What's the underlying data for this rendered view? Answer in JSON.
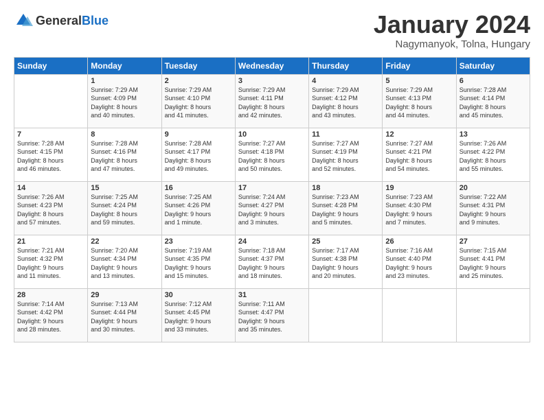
{
  "logo": {
    "general": "General",
    "blue": "Blue"
  },
  "header": {
    "month": "January 2024",
    "location": "Nagymanyok, Tolna, Hungary"
  },
  "days_of_week": [
    "Sunday",
    "Monday",
    "Tuesday",
    "Wednesday",
    "Thursday",
    "Friday",
    "Saturday"
  ],
  "weeks": [
    [
      {
        "day": "",
        "info": ""
      },
      {
        "day": "1",
        "info": "Sunrise: 7:29 AM\nSunset: 4:09 PM\nDaylight: 8 hours\nand 40 minutes."
      },
      {
        "day": "2",
        "info": "Sunrise: 7:29 AM\nSunset: 4:10 PM\nDaylight: 8 hours\nand 41 minutes."
      },
      {
        "day": "3",
        "info": "Sunrise: 7:29 AM\nSunset: 4:11 PM\nDaylight: 8 hours\nand 42 minutes."
      },
      {
        "day": "4",
        "info": "Sunrise: 7:29 AM\nSunset: 4:12 PM\nDaylight: 8 hours\nand 43 minutes."
      },
      {
        "day": "5",
        "info": "Sunrise: 7:29 AM\nSunset: 4:13 PM\nDaylight: 8 hours\nand 44 minutes."
      },
      {
        "day": "6",
        "info": "Sunrise: 7:28 AM\nSunset: 4:14 PM\nDaylight: 8 hours\nand 45 minutes."
      }
    ],
    [
      {
        "day": "7",
        "info": "Sunrise: 7:28 AM\nSunset: 4:15 PM\nDaylight: 8 hours\nand 46 minutes."
      },
      {
        "day": "8",
        "info": "Sunrise: 7:28 AM\nSunset: 4:16 PM\nDaylight: 8 hours\nand 47 minutes."
      },
      {
        "day": "9",
        "info": "Sunrise: 7:28 AM\nSunset: 4:17 PM\nDaylight: 8 hours\nand 49 minutes."
      },
      {
        "day": "10",
        "info": "Sunrise: 7:27 AM\nSunset: 4:18 PM\nDaylight: 8 hours\nand 50 minutes."
      },
      {
        "day": "11",
        "info": "Sunrise: 7:27 AM\nSunset: 4:19 PM\nDaylight: 8 hours\nand 52 minutes."
      },
      {
        "day": "12",
        "info": "Sunrise: 7:27 AM\nSunset: 4:21 PM\nDaylight: 8 hours\nand 54 minutes."
      },
      {
        "day": "13",
        "info": "Sunrise: 7:26 AM\nSunset: 4:22 PM\nDaylight: 8 hours\nand 55 minutes."
      }
    ],
    [
      {
        "day": "14",
        "info": "Sunrise: 7:26 AM\nSunset: 4:23 PM\nDaylight: 8 hours\nand 57 minutes."
      },
      {
        "day": "15",
        "info": "Sunrise: 7:25 AM\nSunset: 4:24 PM\nDaylight: 8 hours\nand 59 minutes."
      },
      {
        "day": "16",
        "info": "Sunrise: 7:25 AM\nSunset: 4:26 PM\nDaylight: 9 hours\nand 1 minute."
      },
      {
        "day": "17",
        "info": "Sunrise: 7:24 AM\nSunset: 4:27 PM\nDaylight: 9 hours\nand 3 minutes."
      },
      {
        "day": "18",
        "info": "Sunrise: 7:23 AM\nSunset: 4:28 PM\nDaylight: 9 hours\nand 5 minutes."
      },
      {
        "day": "19",
        "info": "Sunrise: 7:23 AM\nSunset: 4:30 PM\nDaylight: 9 hours\nand 7 minutes."
      },
      {
        "day": "20",
        "info": "Sunrise: 7:22 AM\nSunset: 4:31 PM\nDaylight: 9 hours\nand 9 minutes."
      }
    ],
    [
      {
        "day": "21",
        "info": "Sunrise: 7:21 AM\nSunset: 4:32 PM\nDaylight: 9 hours\nand 11 minutes."
      },
      {
        "day": "22",
        "info": "Sunrise: 7:20 AM\nSunset: 4:34 PM\nDaylight: 9 hours\nand 13 minutes."
      },
      {
        "day": "23",
        "info": "Sunrise: 7:19 AM\nSunset: 4:35 PM\nDaylight: 9 hours\nand 15 minutes."
      },
      {
        "day": "24",
        "info": "Sunrise: 7:18 AM\nSunset: 4:37 PM\nDaylight: 9 hours\nand 18 minutes."
      },
      {
        "day": "25",
        "info": "Sunrise: 7:17 AM\nSunset: 4:38 PM\nDaylight: 9 hours\nand 20 minutes."
      },
      {
        "day": "26",
        "info": "Sunrise: 7:16 AM\nSunset: 4:40 PM\nDaylight: 9 hours\nand 23 minutes."
      },
      {
        "day": "27",
        "info": "Sunrise: 7:15 AM\nSunset: 4:41 PM\nDaylight: 9 hours\nand 25 minutes."
      }
    ],
    [
      {
        "day": "28",
        "info": "Sunrise: 7:14 AM\nSunset: 4:42 PM\nDaylight: 9 hours\nand 28 minutes."
      },
      {
        "day": "29",
        "info": "Sunrise: 7:13 AM\nSunset: 4:44 PM\nDaylight: 9 hours\nand 30 minutes."
      },
      {
        "day": "30",
        "info": "Sunrise: 7:12 AM\nSunset: 4:45 PM\nDaylight: 9 hours\nand 33 minutes."
      },
      {
        "day": "31",
        "info": "Sunrise: 7:11 AM\nSunset: 4:47 PM\nDaylight: 9 hours\nand 35 minutes."
      },
      {
        "day": "",
        "info": ""
      },
      {
        "day": "",
        "info": ""
      },
      {
        "day": "",
        "info": ""
      }
    ]
  ]
}
